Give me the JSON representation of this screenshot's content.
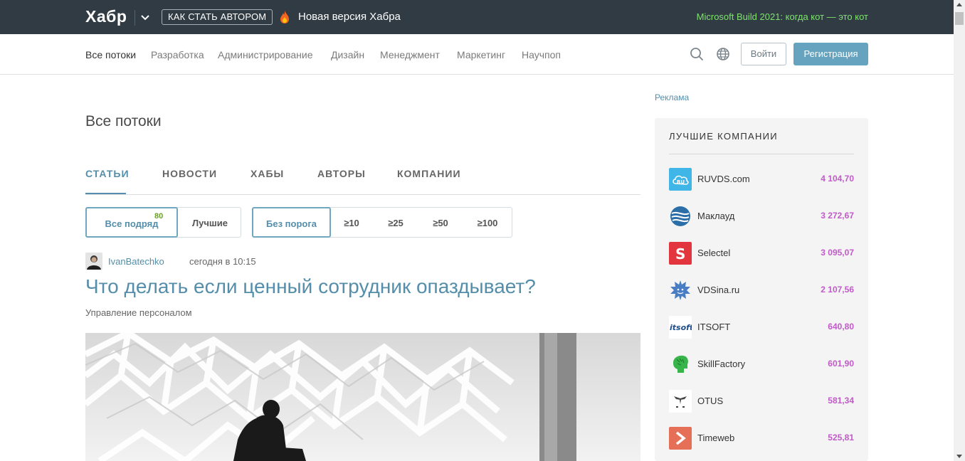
{
  "header": {
    "logo": "Хабр",
    "author_button": "КАК СТАТЬ АВТОРОМ",
    "new_version": "Новая версия Хабра",
    "promo": "Microsoft Build 2021: когда кот — это кот"
  },
  "nav": {
    "items": [
      "Все потоки",
      "Разработка",
      "Администрирование",
      "Дизайн",
      "Менеджмент",
      "Маркетинг",
      "Научпоп"
    ],
    "active": "Все потоки",
    "login": "Войти",
    "register": "Регистрация",
    "icons": [
      "search-icon",
      "globe-icon"
    ]
  },
  "main": {
    "page_title": "Все потоки",
    "tabs": [
      "СТАТЬИ",
      "НОВОСТИ",
      "ХАБЫ",
      "АВТОРЫ",
      "КОМПАНИИ"
    ],
    "active_tab": "СТАТЬИ",
    "filters_sort": [
      {
        "label": "Все подряд",
        "badge": "80"
      },
      {
        "label": "Лучшие"
      }
    ],
    "filters_threshold": [
      "Без порога",
      "≥10",
      "≥25",
      "≥50",
      "≥100"
    ]
  },
  "post": {
    "author": "IvanBatechko",
    "time": "сегодня в 10:15",
    "title": "Что делать если ценный сотрудник опаздывает?",
    "hub": "Управление персоналом"
  },
  "sidebar": {
    "ad_label": "Реклама",
    "companies_title": "ЛУЧШИЕ КОМПАНИИ",
    "companies": [
      {
        "name": "RUVDS.com",
        "score": "4 104,70",
        "icon": "ruvds-logo",
        "color": "#3fb5e8"
      },
      {
        "name": "Маклауд",
        "score": "3 272,67",
        "icon": "macloud-logo",
        "color": "#2b6ea8"
      },
      {
        "name": "Selectel",
        "score": "3 095,07",
        "icon": "selectel-logo",
        "color": "#e3353d"
      },
      {
        "name": "VDSina.ru",
        "score": "2 107,56",
        "icon": "vdsina-logo",
        "color": "#4a7ec4"
      },
      {
        "name": "ITSOFT",
        "score": "640,80",
        "icon": "itsoft-logo",
        "color": "#1f4f8c"
      },
      {
        "name": "SkillFactory",
        "score": "601,90",
        "icon": "skillfactory-logo",
        "color": "#38b54a"
      },
      {
        "name": "OTUS",
        "score": "581,34",
        "icon": "otus-logo",
        "color": "#444444"
      },
      {
        "name": "Timeweb",
        "score": "525,81",
        "icon": "timeweb-logo",
        "color": "#e56f57"
      }
    ]
  },
  "colors": {
    "topbar": "#303b44",
    "link": "#548eaa",
    "promo": "#7de36b",
    "score": "#c05ac8",
    "register": "#65a3be"
  }
}
